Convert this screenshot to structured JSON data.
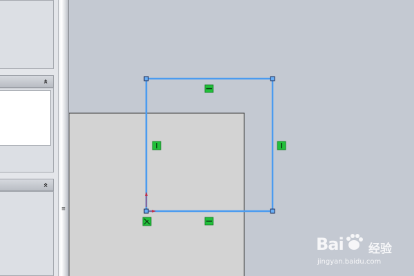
{
  "property_manager": {
    "section_1": {
      "collapse_glyph": "«"
    },
    "section_2": {
      "collapse_glyph": "«"
    }
  },
  "splitter": {
    "grip_glyph": "≡"
  },
  "sketch": {
    "line_color": "#4a9bf0",
    "relation_color": "#21c03a",
    "relation_icons": [
      "horizontal-relation-icon",
      "vertical-relation-icon",
      "vertical-relation-icon",
      "horizontal-relation-icon",
      "coincident-relation-icon"
    ]
  },
  "watermark": {
    "brand": "Bai",
    "brand_sub": "经验",
    "url": "jingyan.baidu.com"
  }
}
